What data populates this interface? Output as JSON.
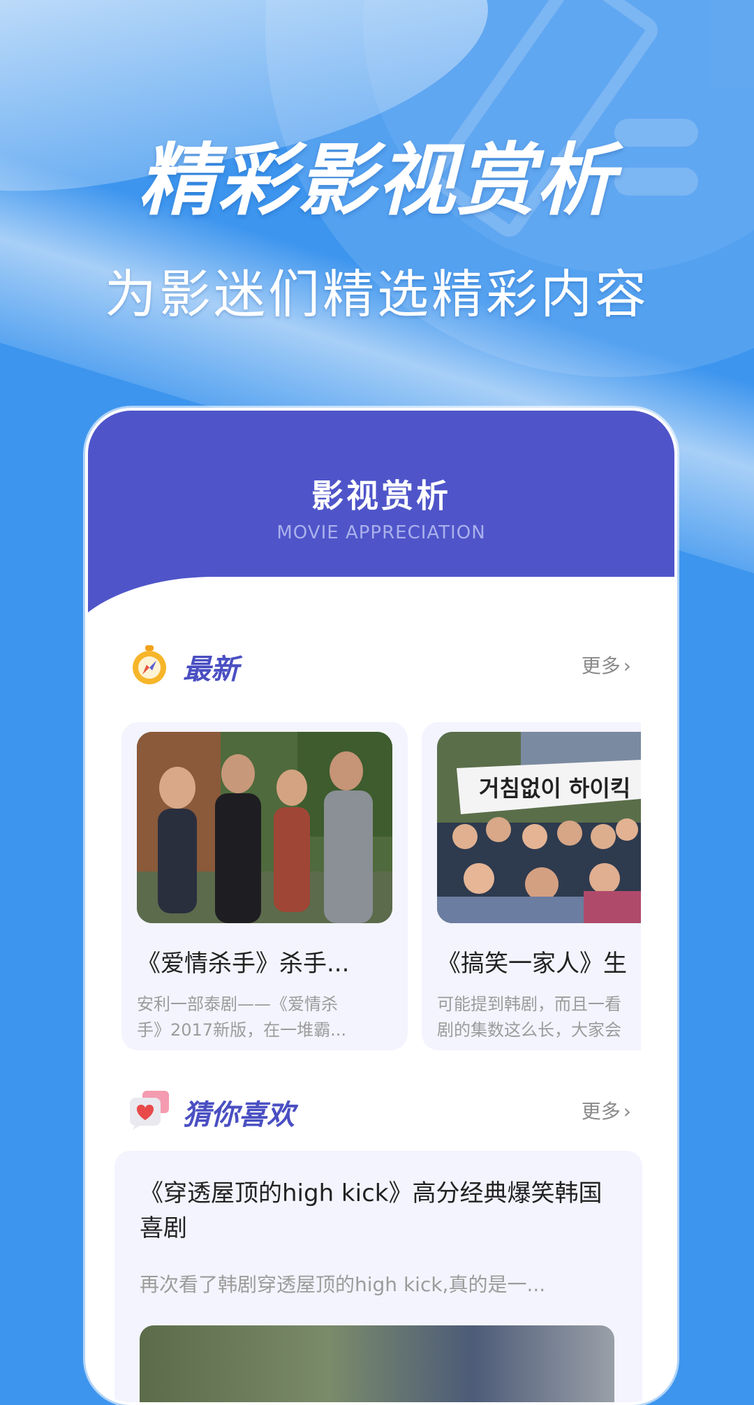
{
  "promo": {
    "headline": "精彩影视赏析",
    "subheadline": "为影迷们精选精彩内容"
  },
  "app": {
    "header_title": "影视赏析",
    "header_subtitle": "MOVIE APPRECIATION"
  },
  "latest": {
    "title": "最新",
    "more_label": "更多",
    "cards": [
      {
        "title": "《爱情杀手》杀手...",
        "desc_line1": "安利一部泰剧——《爱情杀",
        "desc_line2": "手》2017新版，在一堆霸..."
      },
      {
        "title": "《搞笑一家人》生",
        "desc_line1": "可能提到韩剧，而且一看",
        "desc_line2": "剧的集数这么长，大家会",
        "banner_text": "거침없이 하이킥"
      }
    ]
  },
  "recommend": {
    "title": "猜你喜欢",
    "more_label": "更多",
    "item": {
      "title": "《穿透屋顶的high kick》高分经典爆笑韩国喜剧",
      "desc": "再次看了韩剧穿透屋顶的high kick,真的是一..."
    }
  }
}
